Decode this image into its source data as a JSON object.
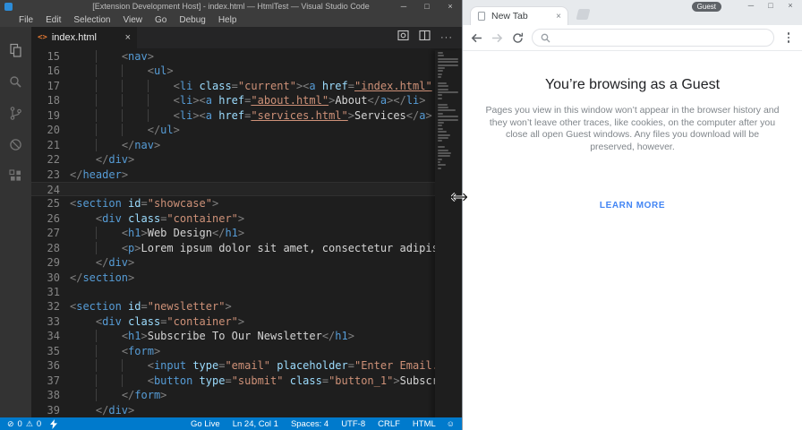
{
  "vscode": {
    "title": "[Extension Development Host] - index.html — HtmlTest — Visual Studio Code",
    "menu": [
      "File",
      "Edit",
      "Selection",
      "View",
      "Go",
      "Debug",
      "Help"
    ],
    "activity_bar": [
      "explorer",
      "search",
      "source-control",
      "debug",
      "extensions"
    ],
    "tab_label": "index.html",
    "editor": {
      "current_line": 24,
      "lines": [
        {
          "n": 15,
          "t": [
            [
              "i",
              8
            ],
            [
              "p",
              "<"
            ],
            [
              "t",
              "nav"
            ],
            [
              "p",
              ">"
            ]
          ]
        },
        {
          "n": 16,
          "t": [
            [
              "i",
              12
            ],
            [
              "p",
              "<"
            ],
            [
              "t",
              "ul"
            ],
            [
              "p",
              ">"
            ]
          ]
        },
        {
          "n": 17,
          "t": [
            [
              "i",
              16
            ],
            [
              "p",
              "<"
            ],
            [
              "t",
              "li"
            ],
            [
              "x",
              " "
            ],
            [
              "a",
              "class"
            ],
            [
              "p",
              "="
            ],
            [
              "s",
              "\"current\""
            ],
            [
              "p",
              "><"
            ],
            [
              "t",
              "a"
            ],
            [
              "x",
              " "
            ],
            [
              "a",
              "href"
            ],
            [
              "p",
              "="
            ],
            [
              "l",
              "\"index.html\""
            ]
          ]
        },
        {
          "n": 18,
          "t": [
            [
              "i",
              16
            ],
            [
              "p",
              "<"
            ],
            [
              "t",
              "li"
            ],
            [
              "p",
              "><"
            ],
            [
              "t",
              "a"
            ],
            [
              "x",
              " "
            ],
            [
              "a",
              "href"
            ],
            [
              "p",
              "="
            ],
            [
              "l",
              "\"about.html\""
            ],
            [
              "p",
              ">"
            ],
            [
              "x",
              "About"
            ],
            [
              "p",
              "</"
            ],
            [
              "t",
              "a"
            ],
            [
              "p",
              "></"
            ],
            [
              "t",
              "li"
            ],
            [
              "p",
              ">"
            ]
          ]
        },
        {
          "n": 19,
          "t": [
            [
              "i",
              16
            ],
            [
              "p",
              "<"
            ],
            [
              "t",
              "li"
            ],
            [
              "p",
              "><"
            ],
            [
              "t",
              "a"
            ],
            [
              "x",
              " "
            ],
            [
              "a",
              "href"
            ],
            [
              "p",
              "="
            ],
            [
              "l",
              "\"services.html\""
            ],
            [
              "p",
              ">"
            ],
            [
              "x",
              "Services"
            ],
            [
              "p",
              "</"
            ],
            [
              "t",
              "a"
            ],
            [
              "p",
              ">"
            ]
          ]
        },
        {
          "n": 20,
          "t": [
            [
              "i",
              12
            ],
            [
              "p",
              "</"
            ],
            [
              "t",
              "ul"
            ],
            [
              "p",
              ">"
            ]
          ]
        },
        {
          "n": 21,
          "t": [
            [
              "i",
              8
            ],
            [
              "p",
              "</"
            ],
            [
              "t",
              "nav"
            ],
            [
              "p",
              ">"
            ]
          ]
        },
        {
          "n": 22,
          "t": [
            [
              "i",
              4
            ],
            [
              "p",
              "</"
            ],
            [
              "t",
              "div"
            ],
            [
              "p",
              ">"
            ]
          ]
        },
        {
          "n": 23,
          "t": [
            [
              "p",
              "</"
            ],
            [
              "t",
              "header"
            ],
            [
              "p",
              ">"
            ]
          ]
        },
        {
          "n": 24,
          "t": []
        },
        {
          "n": 25,
          "t": [
            [
              "p",
              "<"
            ],
            [
              "t",
              "section"
            ],
            [
              "x",
              " "
            ],
            [
              "a",
              "id"
            ],
            [
              "p",
              "="
            ],
            [
              "s",
              "\"showcase\""
            ],
            [
              "p",
              ">"
            ]
          ]
        },
        {
          "n": 26,
          "t": [
            [
              "i",
              4
            ],
            [
              "p",
              "<"
            ],
            [
              "t",
              "div"
            ],
            [
              "x",
              " "
            ],
            [
              "a",
              "class"
            ],
            [
              "p",
              "="
            ],
            [
              "s",
              "\"container\""
            ],
            [
              "p",
              ">"
            ]
          ]
        },
        {
          "n": 27,
          "t": [
            [
              "i",
              8
            ],
            [
              "p",
              "<"
            ],
            [
              "t",
              "h1"
            ],
            [
              "p",
              ">"
            ],
            [
              "x",
              "Web Design"
            ],
            [
              "p",
              "</"
            ],
            [
              "t",
              "h1"
            ],
            [
              "p",
              ">"
            ]
          ]
        },
        {
          "n": 28,
          "t": [
            [
              "i",
              8
            ],
            [
              "p",
              "<"
            ],
            [
              "t",
              "p"
            ],
            [
              "p",
              ">"
            ],
            [
              "x",
              "Lorem ipsum dolor sit amet, consectetur adipis"
            ]
          ]
        },
        {
          "n": 29,
          "t": [
            [
              "i",
              4
            ],
            [
              "p",
              "</"
            ],
            [
              "t",
              "div"
            ],
            [
              "p",
              ">"
            ]
          ]
        },
        {
          "n": 30,
          "t": [
            [
              "p",
              "</"
            ],
            [
              "t",
              "section"
            ],
            [
              "p",
              ">"
            ]
          ]
        },
        {
          "n": 31,
          "t": []
        },
        {
          "n": 32,
          "t": [
            [
              "p",
              "<"
            ],
            [
              "t",
              "section"
            ],
            [
              "x",
              " "
            ],
            [
              "a",
              "id"
            ],
            [
              "p",
              "="
            ],
            [
              "s",
              "\"newsletter\""
            ],
            [
              "p",
              ">"
            ]
          ]
        },
        {
          "n": 33,
          "t": [
            [
              "i",
              4
            ],
            [
              "p",
              "<"
            ],
            [
              "t",
              "div"
            ],
            [
              "x",
              " "
            ],
            [
              "a",
              "class"
            ],
            [
              "p",
              "="
            ],
            [
              "s",
              "\"container\""
            ],
            [
              "p",
              ">"
            ]
          ]
        },
        {
          "n": 34,
          "t": [
            [
              "i",
              8
            ],
            [
              "p",
              "<"
            ],
            [
              "t",
              "h1"
            ],
            [
              "p",
              ">"
            ],
            [
              "x",
              "Subscribe To Our Newsletter"
            ],
            [
              "p",
              "</"
            ],
            [
              "t",
              "h1"
            ],
            [
              "p",
              ">"
            ]
          ]
        },
        {
          "n": 35,
          "t": [
            [
              "i",
              8
            ],
            [
              "p",
              "<"
            ],
            [
              "t",
              "form"
            ],
            [
              "p",
              ">"
            ]
          ]
        },
        {
          "n": 36,
          "t": [
            [
              "i",
              12
            ],
            [
              "p",
              "<"
            ],
            [
              "t",
              "input"
            ],
            [
              "x",
              " "
            ],
            [
              "a",
              "type"
            ],
            [
              "p",
              "="
            ],
            [
              "s",
              "\"email\""
            ],
            [
              "x",
              " "
            ],
            [
              "a",
              "placeholder"
            ],
            [
              "p",
              "="
            ],
            [
              "s",
              "\"Enter Email.."
            ]
          ]
        },
        {
          "n": 37,
          "t": [
            [
              "i",
              12
            ],
            [
              "p",
              "<"
            ],
            [
              "t",
              "button"
            ],
            [
              "x",
              " "
            ],
            [
              "a",
              "type"
            ],
            [
              "p",
              "="
            ],
            [
              "s",
              "\"submit\""
            ],
            [
              "x",
              " "
            ],
            [
              "a",
              "class"
            ],
            [
              "p",
              "="
            ],
            [
              "s",
              "\"button_1\""
            ],
            [
              "p",
              ">"
            ],
            [
              "x",
              "Subscri"
            ]
          ]
        },
        {
          "n": 38,
          "t": [
            [
              "i",
              8
            ],
            [
              "p",
              "</"
            ],
            [
              "t",
              "form"
            ],
            [
              "p",
              ">"
            ]
          ]
        },
        {
          "n": 39,
          "t": [
            [
              "i",
              4
            ],
            [
              "p",
              "</"
            ],
            [
              "t",
              "div"
            ],
            [
              "p",
              ">"
            ]
          ]
        }
      ],
      "minimap_extra": [
        14,
        22,
        30,
        26,
        10,
        0,
        18,
        26,
        34,
        30,
        12,
        6,
        20,
        8
      ]
    },
    "status_bar": {
      "errors": "0",
      "warnings": "0",
      "items": [
        "Go Live",
        "Ln 24, Col 1",
        "Spaces: 4",
        "UTF-8",
        "CRLF",
        "HTML"
      ]
    }
  },
  "browser": {
    "tab_title": "New Tab",
    "profile_label": "Guest",
    "address_value": "",
    "heading": "You’re browsing as a Guest",
    "body": "Pages you view in this window won’t appear in the browser history and they won’t leave other traces, like cookies, on the computer after you close all open Guest windows. Any files you download will be preserved, however.",
    "learn_more": "LEARN MORE"
  },
  "icons": {
    "minimize": "─",
    "maximize": "□",
    "close": "×",
    "tab_close": "×",
    "html_tag": "<>",
    "more_actions": "···",
    "error": "⊘",
    "warning": "⚠",
    "smiley": "☺"
  },
  "colors": {
    "status_bar": "#007acc",
    "code_tag": "#569cd6",
    "code_attr": "#9cdcfe",
    "code_string": "#ce9178",
    "link_blue": "#4285f4",
    "html_icon_orange": "#e37933"
  }
}
